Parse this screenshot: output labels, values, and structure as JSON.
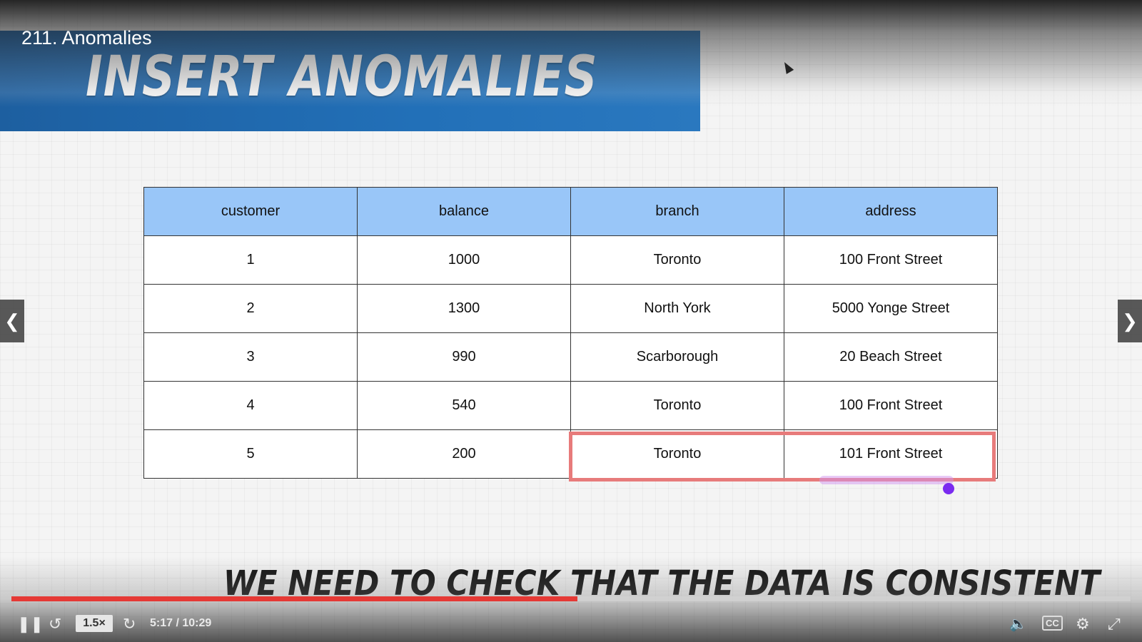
{
  "lecture": {
    "title": "211. Anomalies"
  },
  "slide": {
    "title": "INSERT ANOMALIES",
    "caption": "WE NEED TO CHECK THAT THE DATA IS CONSISTENT",
    "table": {
      "headers": [
        "customer",
        "balance",
        "branch",
        "address"
      ],
      "rows": [
        [
          "1",
          "1000",
          "Toronto",
          "100 Front Street"
        ],
        [
          "2",
          "1300",
          "North York",
          "5000 Yonge Street"
        ],
        [
          "3",
          "990",
          "Scarborough",
          "20 Beach Street"
        ],
        [
          "4",
          "540",
          "Toronto",
          "100 Front Street"
        ],
        [
          "5",
          "200",
          "Toronto",
          "101 Front Street"
        ]
      ],
      "highlighted_row": 5,
      "highlight_color": "#e77b7b",
      "header_color": "#99c6f8"
    },
    "banner_color": "#1d5fa0"
  },
  "player": {
    "speed": "1.5×",
    "current_time": "5:17",
    "duration": "10:29",
    "time_label": "5:17 / 10:29",
    "progress_fraction": 0.506,
    "progress_color": "#e53935",
    "icons": [
      "pause-icon",
      "rewind-icon",
      "forward-icon",
      "volume-icon",
      "captions-icon",
      "settings-icon",
      "exit-fullscreen-icon",
      "prev-arrow-icon",
      "next-arrow-icon"
    ]
  }
}
